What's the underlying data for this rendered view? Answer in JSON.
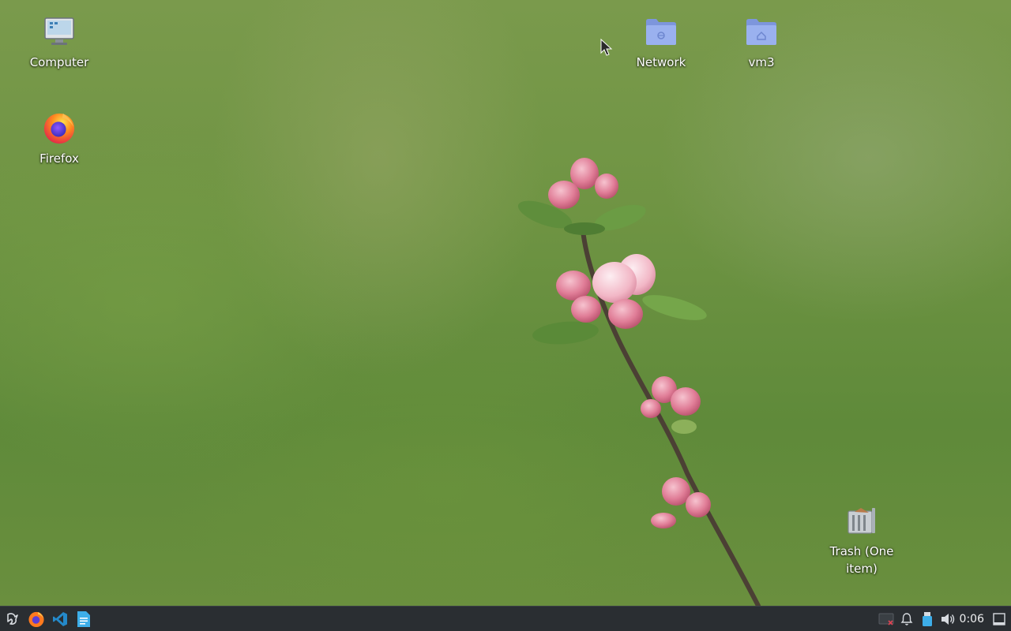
{
  "desktop": {
    "icons": [
      {
        "label": "Computer",
        "icon": "computer-icon"
      },
      {
        "label": "Firefox",
        "icon": "firefox-icon"
      },
      {
        "label": "Network",
        "icon": "network-folder-icon"
      },
      {
        "label": "vm3",
        "icon": "home-folder-icon"
      },
      {
        "label": "Trash (One item)",
        "icon": "trash-full-icon"
      }
    ]
  },
  "taskbar": {
    "launchers": [
      {
        "name": "application-menu",
        "icon": "app-menu-icon"
      },
      {
        "name": "firefox",
        "icon": "firefox-icon"
      },
      {
        "name": "visual-studio-code",
        "icon": "vscode-icon"
      },
      {
        "name": "text-editor",
        "icon": "document-icon"
      }
    ],
    "tray": [
      {
        "name": "network-status",
        "icon": "network-disconnected-icon"
      },
      {
        "name": "notifications",
        "icon": "bell-icon"
      },
      {
        "name": "removable-devices",
        "icon": "usb-drive-icon"
      },
      {
        "name": "volume",
        "icon": "speaker-icon"
      }
    ],
    "clock": "0:06"
  },
  "colors": {
    "taskbar_bg": "#2a2e32",
    "folder_blue": "#8fa8e8",
    "accent_blue": "#1d99f3"
  }
}
